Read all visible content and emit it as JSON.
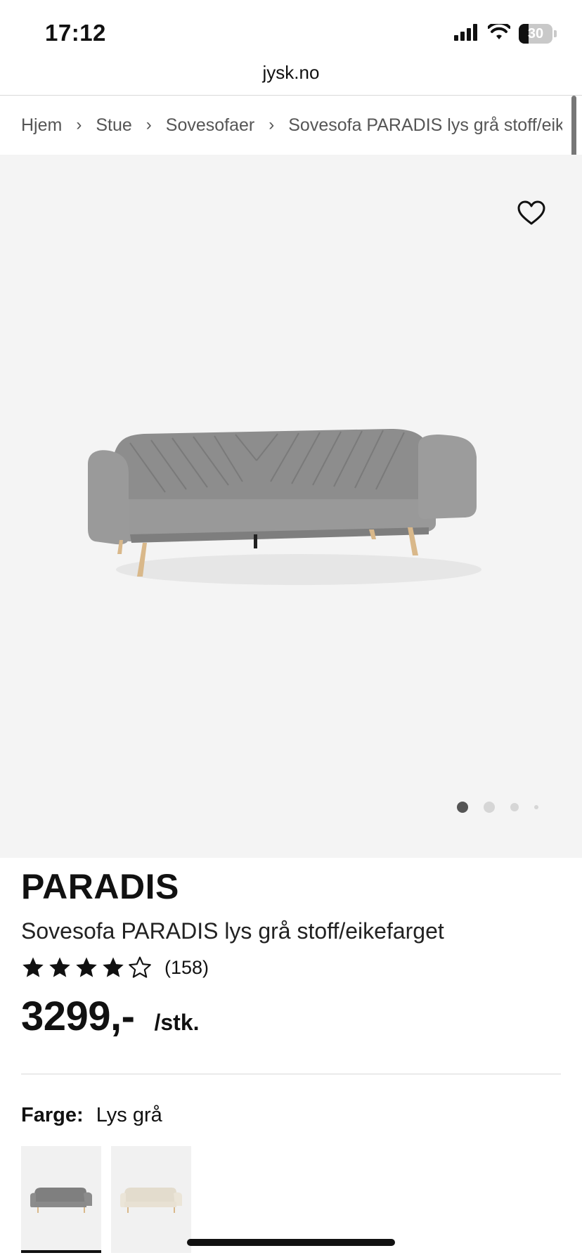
{
  "status_bar": {
    "time": "17:12",
    "battery": "30",
    "icons": [
      "signal-icon",
      "wifi-icon",
      "battery-icon"
    ]
  },
  "browser": {
    "url": "jysk.no"
  },
  "breadcrumb": {
    "items": [
      "Hjem",
      "Stue",
      "Sovesofaer",
      "Sovesofa PARADIS lys grå stoff/eikefarget"
    ],
    "separator_icon": "chevron-right-icon"
  },
  "gallery": {
    "favorite_icon": "heart-icon",
    "image_name": "sofa-product-image",
    "dot_count": 4,
    "active_dot": 0
  },
  "product": {
    "brand": "PARADIS",
    "title": "Sovesofa PARADIS lys grå stoff/eikefarget",
    "rating_stars": 4,
    "rating_max": 5,
    "review_count": "(158)",
    "price": "3299,-",
    "price_unit": "/stk."
  },
  "color": {
    "label": "Farge:",
    "value": "Lys grå",
    "options": [
      "Lys grå",
      "Beige"
    ],
    "selected_index": 0
  },
  "colors": {
    "text": "#111111",
    "gallery_bg": "#f4f4f4",
    "sofa_grey": "#8a8a8a",
    "sofa_beige": "#e6dfd2",
    "wood": "#d9b88a"
  }
}
